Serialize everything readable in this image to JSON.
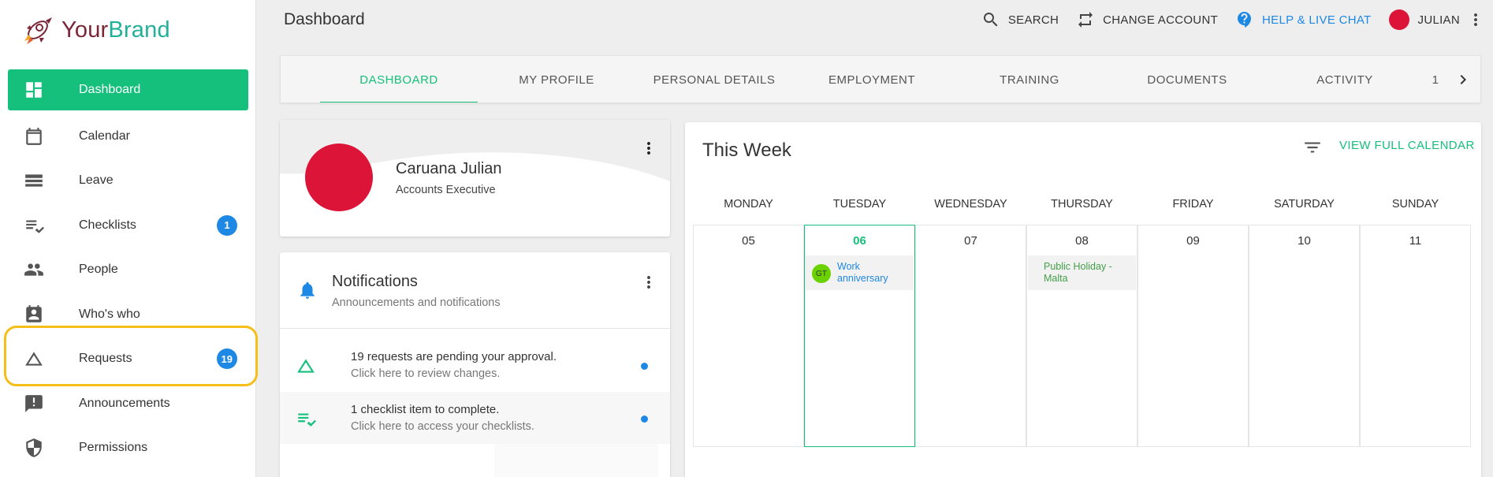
{
  "brand": {
    "part1": "Your",
    "part2": "Brand"
  },
  "sidebar": {
    "items": [
      {
        "label": "Dashboard",
        "icon": "dashboard-icon",
        "active": true,
        "badge": ""
      },
      {
        "label": "Calendar",
        "icon": "calendar-icon",
        "badge": ""
      },
      {
        "label": "Leave",
        "icon": "leave-icon",
        "badge": ""
      },
      {
        "label": "Checklists",
        "icon": "checklist-icon",
        "badge": "1"
      },
      {
        "label": "People",
        "icon": "people-icon",
        "badge": ""
      },
      {
        "label": "Who's who",
        "icon": "id-badge-icon",
        "badge": ""
      },
      {
        "label": "Requests",
        "icon": "triangle-icon",
        "badge": "19"
      },
      {
        "label": "Announcements",
        "icon": "announcement-icon",
        "badge": ""
      },
      {
        "label": "Permissions",
        "icon": "shield-icon",
        "badge": ""
      }
    ]
  },
  "header": {
    "title": "Dashboard",
    "search": "SEARCH",
    "change_account": "CHANGE ACCOUNT",
    "help": "HELP & LIVE CHAT",
    "user": "JULIAN"
  },
  "tabs": [
    "DASHBOARD",
    "MY PROFILE",
    "PERSONAL DETAILS",
    "EMPLOYMENT",
    "TRAINING",
    "DOCUMENTS",
    "ACTIVITY",
    "1"
  ],
  "profile": {
    "name": "Caruana Julian",
    "role": "Accounts Executive"
  },
  "notifications": {
    "title": "Notifications",
    "subtitle": "Announcements and notifications",
    "items": [
      {
        "line1": "19 requests are pending your approval.",
        "line2": "Click here to review changes."
      },
      {
        "line1": "1 checklist item to complete.",
        "line2": "Click here to access your checklists."
      }
    ]
  },
  "calendar": {
    "title": "This Week",
    "view_full": "VIEW FULL CALENDAR",
    "days": [
      "MONDAY",
      "TUESDAY",
      "WEDNESDAY",
      "THURSDAY",
      "FRIDAY",
      "SATURDAY",
      "SUNDAY"
    ],
    "dates": [
      "05",
      "06",
      "07",
      "08",
      "09",
      "10",
      "11"
    ],
    "events": {
      "work_anniversary": {
        "initials": "GT",
        "text": "Work anniversary"
      },
      "holiday": {
        "text": "Public Holiday - Malta"
      }
    }
  },
  "colors": {
    "accent": "#15bf7c",
    "badge": "#1e88e5",
    "avatar": "#dc1438",
    "highlight": "#f5be18"
  }
}
